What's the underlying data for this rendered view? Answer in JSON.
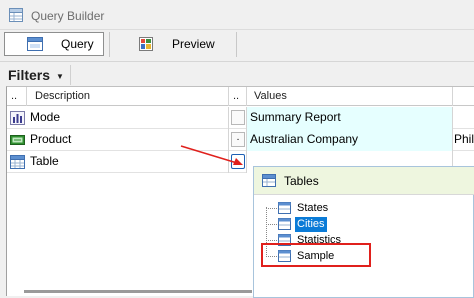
{
  "window": {
    "title": "Query Builder",
    "app_icon": "query-builder-icon"
  },
  "toolbar": {
    "query_label": "Query",
    "query_icon": "grid-icon",
    "preview_label": "Preview",
    "preview_icon": "preview-icon"
  },
  "filters": {
    "label": "Filters",
    "caret_icon": "caret-down-icon"
  },
  "grid": {
    "headers": {
      "marker": "..",
      "description": "Description",
      "dot": "..",
      "values": "Values"
    },
    "rows": [
      {
        "description": "Mode",
        "icon": "bar-chart-icon",
        "dot": "",
        "value": "Summary Report",
        "more": ""
      },
      {
        "description": "Product",
        "icon": "product-icon",
        "dot": ".",
        "value": "Australian Company",
        "more": "Philip"
      },
      {
        "description": "Table",
        "icon": "table-icon",
        "dot": ".",
        "value": "",
        "more": ""
      }
    ],
    "value_bg": "#e6ffff"
  },
  "popup": {
    "title": "Tables",
    "items": [
      {
        "label": "States",
        "selected": false
      },
      {
        "label": "Cities",
        "selected": true
      },
      {
        "label": "Statistics",
        "selected": false
      },
      {
        "label": "Sample",
        "selected": false
      }
    ],
    "selection_color": "#0a7bd7",
    "header_bg": "#eef6df"
  },
  "annotation": {
    "color": "#e0201c"
  }
}
